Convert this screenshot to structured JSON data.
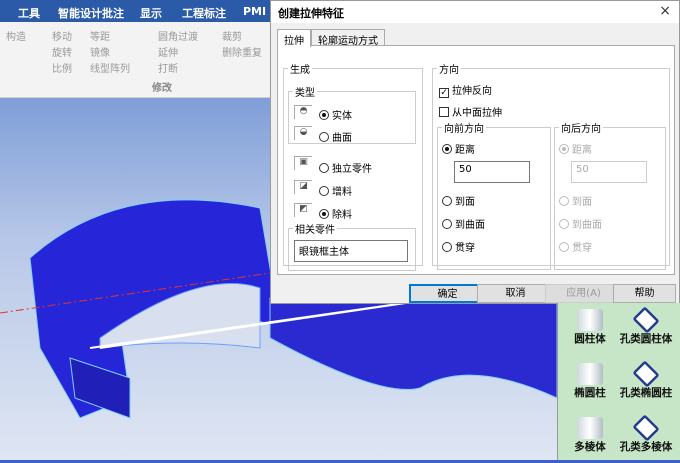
{
  "menubar": [
    "工具",
    "智能设计批注",
    "显示",
    "工程标注",
    "PMI"
  ],
  "ribbon": {
    "items": [
      "构造",
      "移动",
      "等距",
      "旋转",
      "镜像",
      "比例",
      "线型阵列",
      "圆角过渡",
      "延伸",
      "打断",
      "裁剪",
      "删除重复"
    ],
    "group": "修改"
  },
  "dialog": {
    "title": "创建拉伸特征",
    "close": "×",
    "tabs": [
      "拉伸",
      "轮廓运动方式"
    ],
    "generate": {
      "legend": "生成",
      "type_legend": "类型",
      "solid": "实体",
      "surface": "曲面",
      "independent": "独立零件",
      "add": "增料",
      "remove": "除料",
      "related_legend": "相关零件",
      "related_value": "眼镜框主体"
    },
    "direction": {
      "legend": "方向",
      "reverse": "拉伸反向",
      "mid": "从中面拉伸",
      "forward": {
        "legend": "向前方向",
        "distance": "距离",
        "value": "50",
        "to_face": "到面",
        "to_surface": "到曲面",
        "through": "贯穿"
      },
      "backward": {
        "legend": "向后方向",
        "distance": "距离",
        "value": "50",
        "to_face": "到面",
        "to_surface": "到曲面",
        "through": "贯穿"
      }
    },
    "buttons": {
      "ok": "确定",
      "cancel": "取消",
      "apply": "应用(A)",
      "help": "帮助"
    }
  },
  "side_panel": [
    "圆柱体",
    "孔类圆柱体",
    "椭圆柱",
    "孔类椭圆柱",
    "多棱体",
    "孔类多棱体"
  ]
}
